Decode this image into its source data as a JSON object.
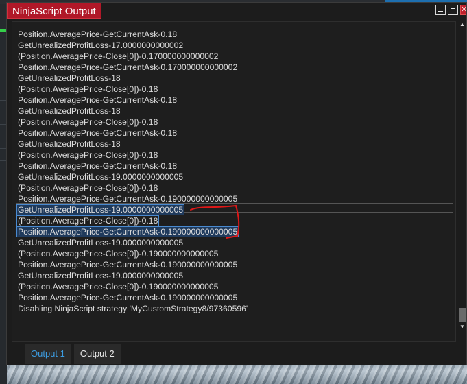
{
  "window": {
    "title": "NinjaScript Output",
    "controls": {
      "minimize": "minimize-icon",
      "maximize": "maximize-icon",
      "close": "close-icon"
    }
  },
  "output": {
    "lines": [
      "Position.AveragePrice-GetCurrentAsk-0.18",
      "GetUnrealizedProfitLoss-17.0000000000002",
      "(Position.AveragePrice-Close[0])-0.170000000000002",
      "Position.AveragePrice-GetCurrentAsk-0.170000000000002",
      "GetUnrealizedProfitLoss-18",
      "(Position.AveragePrice-Close[0])-0.18",
      "Position.AveragePrice-GetCurrentAsk-0.18",
      "GetUnrealizedProfitLoss-18",
      "(Position.AveragePrice-Close[0])-0.18",
      "Position.AveragePrice-GetCurrentAsk-0.18",
      "GetUnrealizedProfitLoss-18",
      "(Position.AveragePrice-Close[0])-0.18",
      "Position.AveragePrice-GetCurrentAsk-0.18",
      "GetUnrealizedProfitLoss-19.0000000000005",
      "(Position.AveragePrice-Close[0])-0.18",
      "Position.AveragePrice-GetCurrentAsk-0.190000000000005",
      "GetUnrealizedProfitLoss-19.0000000000005",
      "(Position.AveragePrice-Close[0])-0.18",
      "Position.AveragePrice-GetCurrentAsk-0.190000000000005",
      "GetUnrealizedProfitLoss-19.0000000000005",
      "(Position.AveragePrice-Close[0])-0.190000000000005",
      "Position.AveragePrice-GetCurrentAsk-0.190000000000005",
      "GetUnrealizedProfitLoss-19.0000000000005",
      "(Position.AveragePrice-Close[0])-0.190000000000005",
      "Position.AveragePrice-GetCurrentAsk-0.190000000000005",
      "Disabling NinjaScript strategy 'MyCustomStrategy8/97360596'"
    ],
    "selected_line_indices": [
      16,
      17,
      18
    ]
  },
  "tabs": [
    {
      "label": "Output 1",
      "active": true
    },
    {
      "label": "Output 2",
      "active": false
    }
  ],
  "colors": {
    "title_bg": "#b01828",
    "active_tab_text": "#3c9be0",
    "selection_outline": "#4a8ad0",
    "annotation_red": "#e01818"
  }
}
